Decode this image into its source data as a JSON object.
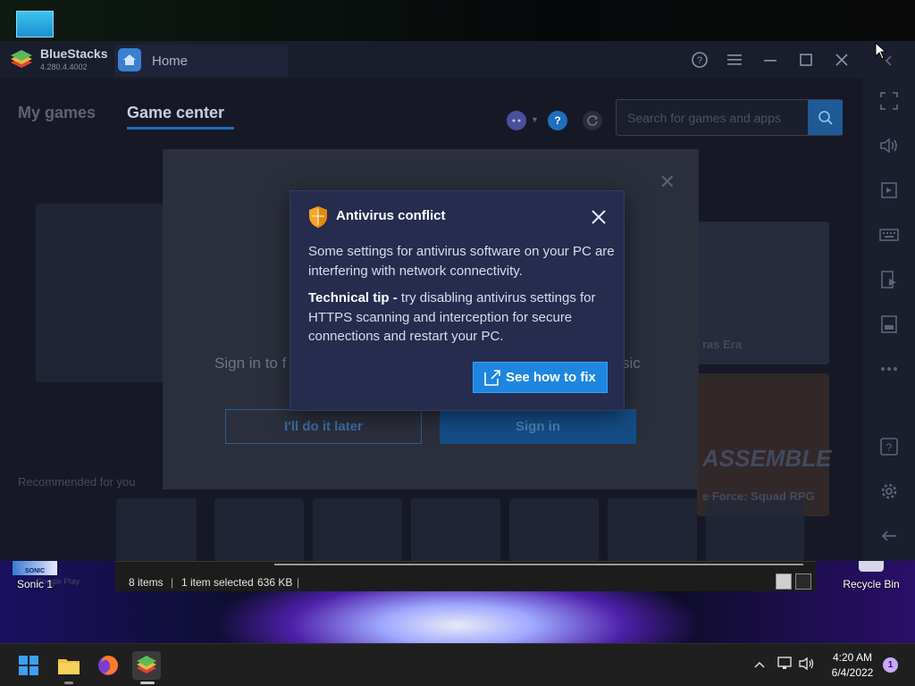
{
  "window": {
    "brand": "BlueStacks",
    "version": "4.280.4.4002",
    "tab_home_label": "Home"
  },
  "nav": {
    "my_games": "My games",
    "game_center": "Game center"
  },
  "search": {
    "placeholder": "Search for games and apps"
  },
  "background_text": {
    "recommended": "Recommended for you",
    "google_play": "Google Play",
    "title_right_1": "ras Era",
    "title_right_2": "ASSEMBLE",
    "title_right_3": "e Force: Squad RPG"
  },
  "signin_modal": {
    "text_left": "Sign in to f",
    "text_right": "sic",
    "later_button": "I'll do it later",
    "signin_button": "Sign in"
  },
  "antivirus_dialog": {
    "title": "Antivirus conflict",
    "body": "Some settings for antivirus software on your PC are interfering with network connectivity.",
    "tip_label": "Technical tip -",
    "tip_text": " try disabling antivirus settings for HTTPS scanning and interception for secure connections and restart your PC.",
    "fix_button": "See how to fix"
  },
  "explorer_status": {
    "items": "8 items",
    "selected": "1 item selected",
    "size": "636 KB"
  },
  "desktop_icons": {
    "sonic_label": "Sonic 1",
    "sonic_thumb_text": "SONIC",
    "recycle_label": "Recycle Bin"
  },
  "taskbar": {
    "time": "4:20 AM",
    "date": "6/4/2022",
    "notification_count": "1"
  },
  "colors": {
    "dialog_bg": "#262c4e",
    "fix_button": "#1d86e0",
    "accent_blue": "#1f6fbf"
  }
}
